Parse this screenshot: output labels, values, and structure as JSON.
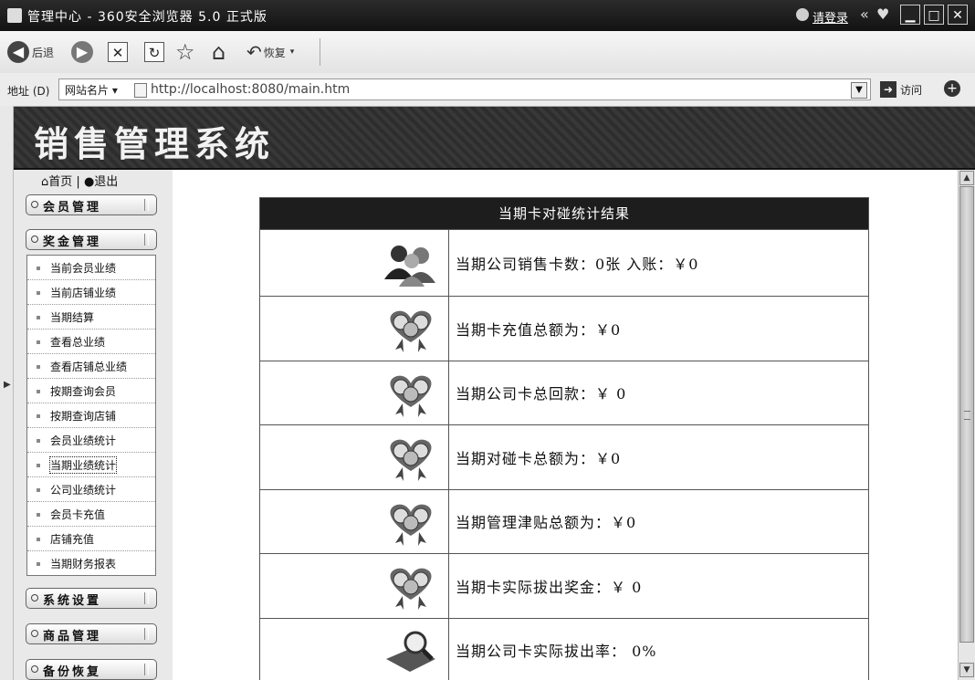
{
  "window": {
    "title": "管理中心 - 360安全浏览器 5.0 正式版",
    "login_link": "请登录",
    "nav_more": "«",
    "minimize": "▁",
    "maximize": "□",
    "close": "✕"
  },
  "toolbar": {
    "back_label": "后退",
    "restore_label": "恢复"
  },
  "address_bar": {
    "label": "地址 (D)",
    "sites_label": "网站名片",
    "url": "http://localhost:8080/main.htm",
    "go_label": "访问"
  },
  "banner": {
    "title": "销售管理系统"
  },
  "sidebar": {
    "home_label": "首页",
    "logout_label": "退出",
    "menus": [
      {
        "label": "会员管理"
      },
      {
        "label": "奖金管理"
      },
      {
        "label": "系统设置"
      },
      {
        "label": "商品管理"
      },
      {
        "label": "备份恢复"
      }
    ],
    "bonus_items": [
      "当前会员业绩",
      "当前店铺业绩",
      "当期结算",
      "查看总业绩",
      "查看店铺总业绩",
      "按期查询会员",
      "按期查询店铺",
      "会员业绩统计",
      "当期业绩统计",
      "公司业绩统计",
      "会员卡充值",
      "店铺充值",
      "当期财务报表"
    ],
    "selected_item": "当期业绩统计"
  },
  "report": {
    "header": "当期卡对碰统计结果",
    "rows": [
      {
        "text": "当期公司销售卡数：0张  入账：￥0",
        "icon": "people-icon"
      },
      {
        "text": "当期卡充值总额为：￥0",
        "icon": "heart-badge-icon"
      },
      {
        "text": "当期公司卡总回款：￥ 0",
        "icon": "heart-badge-icon"
      },
      {
        "text": "当期对碰卡总额为：￥0",
        "icon": "heart-badge-icon"
      },
      {
        "text": "当期管理津贴总额为：￥0",
        "icon": "heart-badge-icon"
      },
      {
        "text": "当期卡实际拔出奖金：￥ 0",
        "icon": "heart-badge-icon"
      },
      {
        "text": "当期公司卡实际拔出率：     0%",
        "icon": "magnifier-icon"
      }
    ]
  }
}
